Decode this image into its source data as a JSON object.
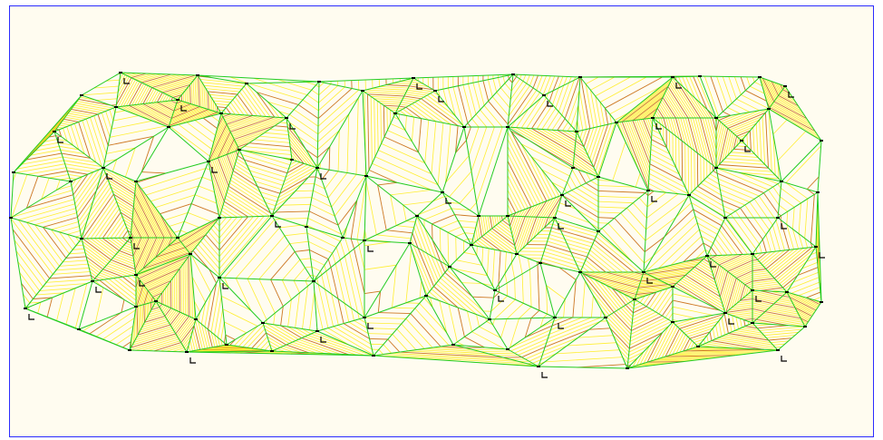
{
  "view": {
    "background": "#fffcf0",
    "frame_color": "#2a2aff",
    "tin_edge_color": "#22cc22",
    "contour_color": "#ffee33",
    "index_contour_color": "#cc7722",
    "spot_mark_color": "#000000",
    "point_mark_symbol": "survey-point-mark"
  }
}
